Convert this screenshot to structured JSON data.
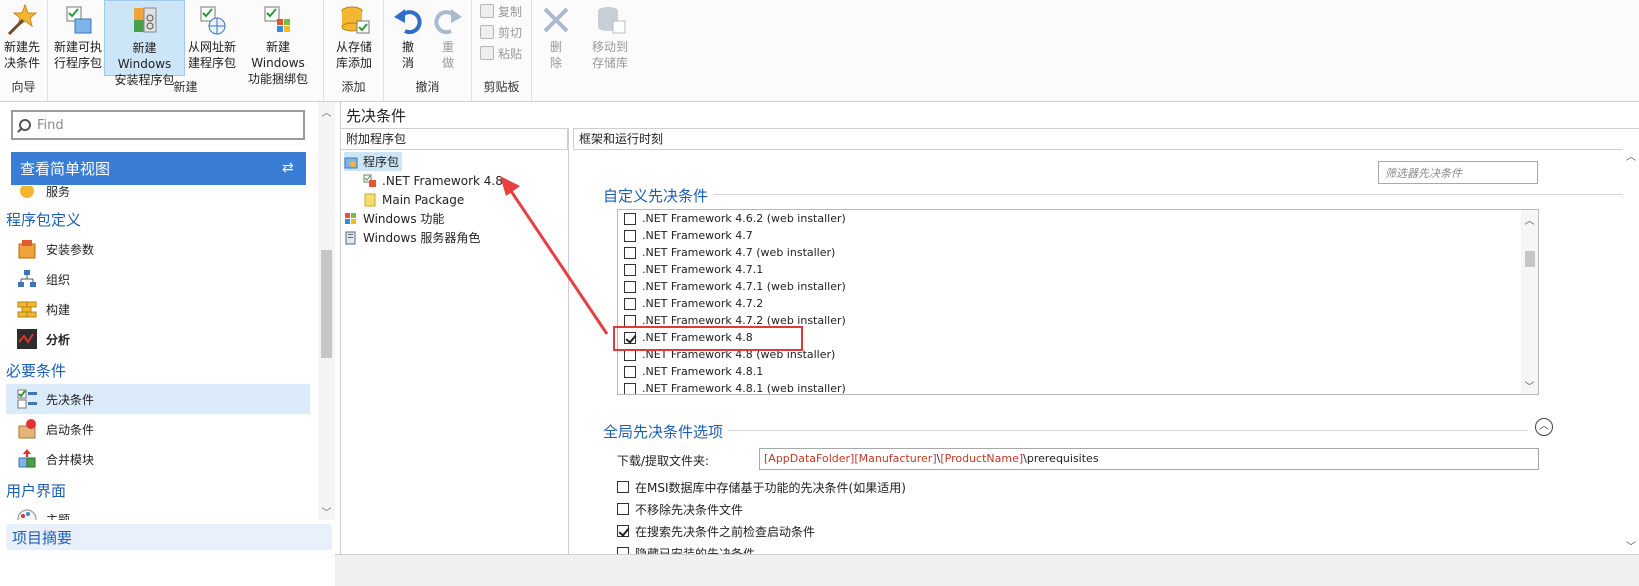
{
  "ribbon": {
    "groups": {
      "wizard": "向导",
      "new": "新建",
      "add": "添加",
      "undo": "撤消",
      "clipboard": "剪贴板"
    },
    "buttons": {
      "new_prereq": "新建先\n决条件",
      "new_exe_pkg": "新建可执\n行程序包",
      "new_windows_installer": "新建 Windows\n安装程序包",
      "from_url": "从网址新\n建程序包",
      "new_feature_bundle": "新建 Windows\n功能捆绑包",
      "add_from_repo": "从存储\n库添加",
      "undo": "撤\n消",
      "redo": "重\n做",
      "copy": "复制",
      "cut": "剪切",
      "paste": "粘贴",
      "delete": "删\n除",
      "move_to_repo": "移动到\n存储库"
    }
  },
  "left": {
    "search_placeholder": "Find",
    "view_bar": "查看简单视图",
    "partial_top": "服务",
    "sections": [
      {
        "head": "程序包定义",
        "items": [
          "安装参数",
          "组织",
          "构建",
          "分析"
        ]
      },
      {
        "head": "必要条件",
        "items": [
          "先决条件",
          "启动条件",
          "合并模块"
        ]
      },
      {
        "head": "用户界面",
        "items": [
          "主题"
        ]
      }
    ],
    "summary": "项目摘要"
  },
  "main": {
    "title": "先决条件",
    "attach_header": "附加程序包",
    "tree": {
      "packages": "程序包",
      "net48": ".NET Framework 4.8",
      "main_package": "Main Package",
      "windows_features": "Windows 功能",
      "windows_server_roles": "Windows 服务器角色"
    },
    "fw_header": "框架和运行时刻",
    "filter_placeholder": "筛选器先决条件",
    "custom_title": "自定义先决条件",
    "checklist": [
      {
        "label": ".NET Framework 4.6.2 (web installer)",
        "checked": false
      },
      {
        "label": ".NET Framework 4.7",
        "checked": false
      },
      {
        "label": ".NET Framework 4.7 (web installer)",
        "checked": false
      },
      {
        "label": ".NET Framework 4.7.1",
        "checked": false
      },
      {
        "label": ".NET Framework 4.7.1 (web installer)",
        "checked": false
      },
      {
        "label": ".NET Framework 4.7.2",
        "checked": false
      },
      {
        "label": ".NET Framework 4.7.2 (web installer)",
        "checked": false
      },
      {
        "label": ".NET Framework 4.8",
        "checked": true
      },
      {
        "label": ".NET Framework 4.8 (web installer)",
        "checked": false
      },
      {
        "label": ".NET Framework 4.8.1",
        "checked": false
      },
      {
        "label": ".NET Framework 4.8.1 (web installer)",
        "checked": false
      }
    ],
    "global_title": "全局先决条件选项",
    "download_label": "下载/提取文件夹:",
    "download_path": {
      "t1": "[AppDataFolder]",
      "t2": "[Manufacturer]",
      "t3": "\\",
      "t4": "[ProductName]",
      "t5": "\\prerequisites"
    },
    "options": [
      {
        "label": "在MSI数据库中存储基于功能的先决条件(如果适用)",
        "checked": false
      },
      {
        "label": "不移除先决条件文件",
        "checked": false
      },
      {
        "label": "在搜索先决条件之前检查启动条件",
        "checked": true
      },
      {
        "label": "隐藏已安装的先决条件",
        "checked": false
      }
    ]
  },
  "colors": {
    "accent": "#3a7dd7",
    "heading": "#1d5fb3",
    "highlight": "#e03a3a",
    "token": "#c0392b"
  }
}
